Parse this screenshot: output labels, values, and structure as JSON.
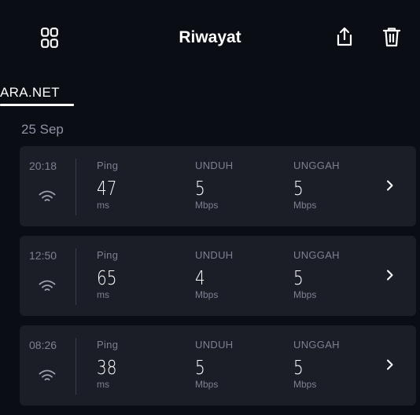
{
  "header": {
    "title": "Riwayat"
  },
  "tab": {
    "label": "ARA.NET"
  },
  "date_group": "25 Sep",
  "results": [
    {
      "time": "20:18",
      "ping_label": "Ping",
      "ping": "47",
      "ping_unit": "ms",
      "download_label": "UNDUH",
      "download": "5",
      "download_unit": "Mbps",
      "upload_label": "UNGGAH",
      "upload": "5",
      "upload_unit": "Mbps"
    },
    {
      "time": "12:50",
      "ping_label": "Ping",
      "ping": "65",
      "ping_unit": "ms",
      "download_label": "UNDUH",
      "download": "4",
      "download_unit": "Mbps",
      "upload_label": "UNGGAH",
      "upload": "5",
      "upload_unit": "Mbps"
    },
    {
      "time": "08:26",
      "ping_label": "Ping",
      "ping": "38",
      "ping_unit": "ms",
      "download_label": "UNDUH",
      "download": "5",
      "download_unit": "Mbps",
      "upload_label": "UNGGAH",
      "upload": "5",
      "upload_unit": "Mbps"
    }
  ]
}
